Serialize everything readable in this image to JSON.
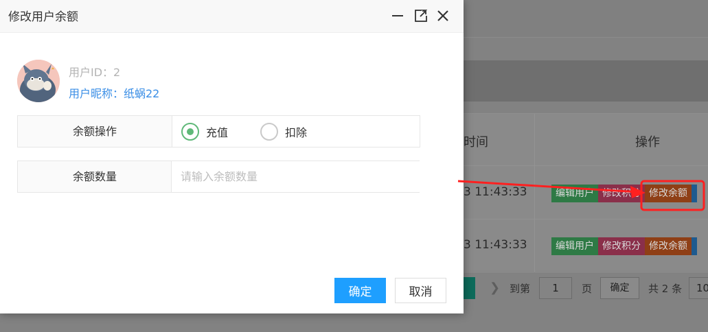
{
  "modal": {
    "title": "修改用户余额",
    "user_id": "用户ID：2",
    "user_nickname": "用户昵称：纸蜗22",
    "form": {
      "balance_op_label": "余额操作",
      "options": [
        "充值",
        "扣除"
      ],
      "selected_option": "充值",
      "amount_label": "余额数量",
      "amount_placeholder": "请输入余额数量",
      "amount_value": ""
    },
    "confirm_label": "确定",
    "cancel_label": "取消"
  },
  "background_table": {
    "header_time": "时间",
    "header_actions": "操作",
    "rows": [
      {
        "time": "3 11:43:33",
        "actions": [
          "编辑用户",
          "修改积分",
          "修改余额"
        ]
      },
      {
        "time": "3 11:43:33",
        "actions": [
          "编辑用户",
          "修改积分",
          "修改余额"
        ]
      }
    ],
    "pagination": {
      "goto_label": "到第",
      "page_value": "1",
      "page_unit": "页",
      "ok_label": "确定",
      "total_text": "共 2 条",
      "page_size": "10"
    }
  },
  "colors": {
    "primary_blue": "#1e9fff",
    "radio_green": "#5fb878",
    "nickname_blue": "#3a8ee6",
    "annotation_red": "#ff2020"
  }
}
